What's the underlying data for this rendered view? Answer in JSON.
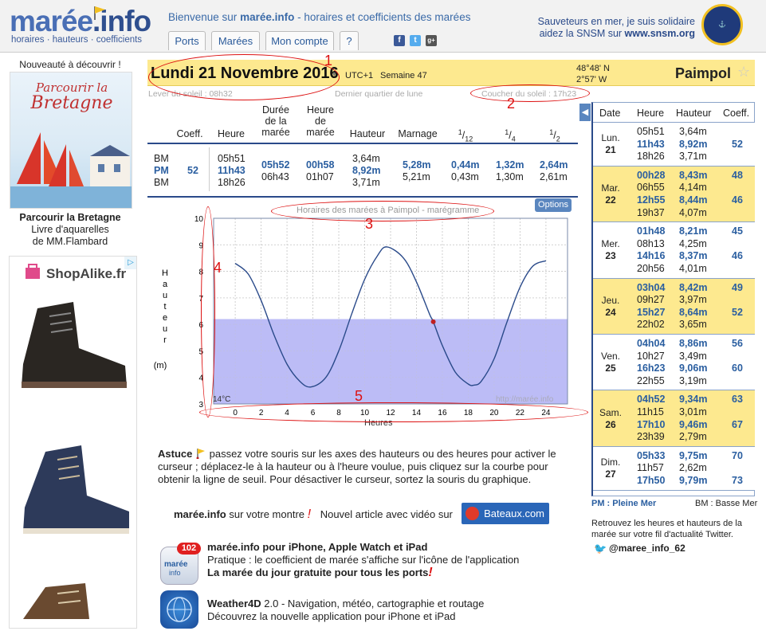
{
  "header": {
    "logo_main": "marée",
    "logo_info": ".info",
    "logo_sub": "horaires · hauteurs · coefficients",
    "welcome_prefix": "Bienvenue sur ",
    "welcome_site": "marée.info",
    "welcome_suffix": " - horaires et coefficients des marées",
    "tabs": [
      "Ports",
      "Marées",
      "Mon compte",
      "?"
    ],
    "social": [
      "f",
      "t",
      "g+"
    ],
    "snsm_line1": "Sauveteurs en mer, je suis solidaire",
    "snsm_line2_prefix": "aidez la SNSM sur ",
    "snsm_line2_link": "www.snsm.org"
  },
  "left_ads": {
    "title": "Nouveauté à découvrir !",
    "book_title": "Parcourir la Bretagne",
    "book_line2": "Livre d'aquarelles",
    "book_line3": "de MM.Flambard",
    "img_title1": "Parcourir la",
    "img_title2": "Bretagne",
    "shop_brand": "ShopAlike.fr",
    "ad_marker": "▷"
  },
  "datebar": {
    "date": "Lundi 21 Novembre 2016",
    "tz": "UTC+1",
    "week": "Semaine 47",
    "lat": "48°48' N",
    "lon": "2°57' W",
    "port": "Paimpol"
  },
  "sun": {
    "lever": "Lever du soleil : 08h32",
    "lune": "Dernier quartier de lune",
    "coucher": "Coucher du soleil : 17h23"
  },
  "annotations": [
    "1",
    "2",
    "3",
    "4",
    "5"
  ],
  "main_table": {
    "headers": {
      "coeff": "Coeff.",
      "heure": "Heure",
      "duree": [
        "Durée",
        "de la",
        "marée"
      ],
      "heure_maree": [
        "Heure",
        "de",
        "marée"
      ],
      "hauteur": "Hauteur",
      "marnage": "Marnage",
      "f12": "1/12",
      "f14": "1/4",
      "f12b": "1/2"
    },
    "types": [
      "BM",
      "PM",
      "BM"
    ],
    "coeff": "52",
    "heures": [
      "05h51",
      "11h43",
      "18h26"
    ],
    "durees": [
      "05h52",
      "06h43"
    ],
    "heures_maree": [
      "00h58",
      "01h07"
    ],
    "hauteurs": [
      "3,64m",
      "8,92m",
      "3,71m"
    ],
    "marnage": [
      "5,28m",
      "5,21m"
    ],
    "douzieme": [
      "0,44m",
      "0,43m"
    ],
    "quart": [
      "1,32m",
      "1,30m"
    ],
    "demi": [
      "2,64m",
      "2,61m"
    ]
  },
  "chart": {
    "title": "Horaires des marées à Paimpol - marégramme",
    "options": "Options",
    "ylabel": [
      "H",
      "a",
      "u",
      "t",
      "e",
      "u",
      "r",
      "",
      "(m)"
    ],
    "xlabel": "Heures",
    "temp": "14°C",
    "watermark": "http://marée.info",
    "yticks": [
      "3",
      "4",
      "5",
      "6",
      "7",
      "8",
      "9",
      "10"
    ],
    "xticks": [
      "0",
      "2",
      "4",
      "6",
      "8",
      "10",
      "12",
      "14",
      "16",
      "18",
      "20",
      "22",
      "24"
    ]
  },
  "chart_data": {
    "type": "line",
    "title": "Horaires des marées à Paimpol - marégramme",
    "xlabel": "Heures",
    "ylabel": "Hauteur (m)",
    "xlim": [
      0,
      24
    ],
    "ylim": [
      3,
      10
    ],
    "grid": true,
    "series": [
      {
        "x": [
          0,
          1,
          2,
          3,
          4,
          5,
          5.85,
          7,
          8,
          9,
          10,
          11,
          11.72,
          13,
          14,
          15,
          15.3,
          16,
          17,
          18,
          18.43,
          19,
          20,
          21,
          22,
          23,
          24
        ],
        "y": [
          8.3,
          7.9,
          6.9,
          5.6,
          4.5,
          3.85,
          3.64,
          4.0,
          5.0,
          6.4,
          7.7,
          8.6,
          8.92,
          8.5,
          7.6,
          6.4,
          6.1,
          5.2,
          4.2,
          3.75,
          3.71,
          3.85,
          4.7,
          6.1,
          7.4,
          8.2,
          8.4
        ]
      }
    ],
    "current_point": {
      "x": 15.3,
      "y": 6.1
    },
    "threshold": 6.2
  },
  "astuce": {
    "label": "Astuce",
    "text": " passez votre souris sur les axes des hauteurs ou des heures pour activer le curseur ; déplacez-le à la hauteur ou à l'heure voulue, puis cliquez sur la courbe pour obtenir la ligne de seuil. Pour désactiver le curseur, sortez la souris du graphique."
  },
  "promo": {
    "montre_site": "marée.info",
    "montre_text": " sur votre montre ",
    "montre_excl": "!",
    "article": "Nouvel article avec vidéo sur",
    "bateaux": "Bateaux.com",
    "iphone_badge": "102",
    "iphone_title": "marée.info pour iPhone, Apple Watch et iPad",
    "iphone_line2": "Pratique : le coefficient de marée s'affiche sur l'icône de l'application",
    "iphone_line3": "La marée du jour gratuite pour tous les ports",
    "iphone_excl": "!",
    "weather_title": "Weather4D",
    "weather_title_rest": " 2.0 - Navigation, météo, cartographie et routage",
    "weather_line2": "Découvrez la nouvelle application pour iPhone et iPad"
  },
  "right_table": {
    "arrow": "◀",
    "headers": [
      "Date",
      "Heure",
      "Hauteur",
      "Coeff."
    ],
    "days": [
      {
        "name": "Lun.",
        "num": "21",
        "hl": false,
        "rows": [
          {
            "h": "05h51",
            "v": "3,64m",
            "c": "",
            "pm": false
          },
          {
            "h": "11h43",
            "v": "8,92m",
            "c": "52",
            "pm": true
          },
          {
            "h": "18h26",
            "v": "3,71m",
            "c": "",
            "pm": false
          }
        ]
      },
      {
        "name": "Mar.",
        "num": "22",
        "hl": true,
        "rows": [
          {
            "h": "00h28",
            "v": "8,43m",
            "c": "48",
            "pm": true
          },
          {
            "h": "06h55",
            "v": "4,14m",
            "c": "",
            "pm": false
          },
          {
            "h": "12h55",
            "v": "8,44m",
            "c": "46",
            "pm": true
          },
          {
            "h": "19h37",
            "v": "4,07m",
            "c": "",
            "pm": false
          }
        ]
      },
      {
        "name": "Mer.",
        "num": "23",
        "hl": false,
        "rows": [
          {
            "h": "01h48",
            "v": "8,21m",
            "c": "45",
            "pm": true
          },
          {
            "h": "08h13",
            "v": "4,25m",
            "c": "",
            "pm": false
          },
          {
            "h": "14h16",
            "v": "8,37m",
            "c": "46",
            "pm": true
          },
          {
            "h": "20h56",
            "v": "4,01m",
            "c": "",
            "pm": false
          }
        ]
      },
      {
        "name": "Jeu.",
        "num": "24",
        "hl": true,
        "rows": [
          {
            "h": "03h04",
            "v": "8,42m",
            "c": "49",
            "pm": true
          },
          {
            "h": "09h27",
            "v": "3,97m",
            "c": "",
            "pm": false
          },
          {
            "h": "15h27",
            "v": "8,64m",
            "c": "52",
            "pm": true
          },
          {
            "h": "22h02",
            "v": "3,65m",
            "c": "",
            "pm": false
          }
        ]
      },
      {
        "name": "Ven.",
        "num": "25",
        "hl": false,
        "rows": [
          {
            "h": "04h04",
            "v": "8,86m",
            "c": "56",
            "pm": true
          },
          {
            "h": "10h27",
            "v": "3,49m",
            "c": "",
            "pm": false
          },
          {
            "h": "16h23",
            "v": "9,06m",
            "c": "60",
            "pm": true
          },
          {
            "h": "22h55",
            "v": "3,19m",
            "c": "",
            "pm": false
          }
        ]
      },
      {
        "name": "Sam.",
        "num": "26",
        "hl": true,
        "rows": [
          {
            "h": "04h52",
            "v": "9,34m",
            "c": "63",
            "pm": true
          },
          {
            "h": "11h15",
            "v": "3,01m",
            "c": "",
            "pm": false
          },
          {
            "h": "17h10",
            "v": "9,46m",
            "c": "67",
            "pm": true
          },
          {
            "h": "23h39",
            "v": "2,79m",
            "c": "",
            "pm": false
          }
        ]
      },
      {
        "name": "Dim.",
        "num": "27",
        "hl": false,
        "rows": [
          {
            "h": "05h33",
            "v": "9,75m",
            "c": "70",
            "pm": true
          },
          {
            "h": "11h57",
            "v": "2,62m",
            "c": "",
            "pm": false
          },
          {
            "h": "17h50",
            "v": "9,79m",
            "c": "73",
            "pm": true
          }
        ]
      }
    ],
    "legend_pm": "PM : Pleine Mer",
    "legend_bm": "BM : Basse Mer",
    "twitter_text": "Retrouvez les heures et hauteurs de la marée sur votre fil d'actualité Twitter.",
    "twitter_handle": "@maree_info_62"
  },
  "colors": {
    "accent": "#2a5ea0",
    "highlight": "#fde98f",
    "annotation": "#dd1111",
    "threshold_fill": "#b8b8f5"
  }
}
